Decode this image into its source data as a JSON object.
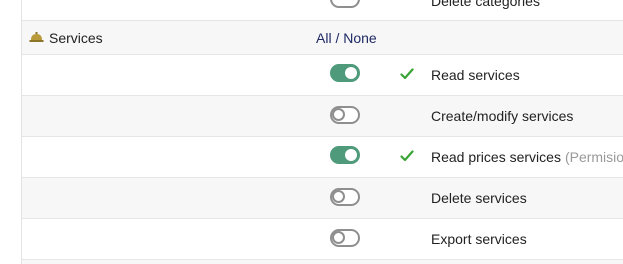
{
  "top_row": {
    "label": "Delete categories",
    "enabled": false
  },
  "section": {
    "title": "Services",
    "icon": "bell-icon",
    "all_label": "All",
    "separator": " / ",
    "none_label": "None"
  },
  "permissions": [
    {
      "label": "Read services",
      "enabled": true,
      "granted": true,
      "hint": ""
    },
    {
      "label": "Create/modify services",
      "enabled": false,
      "granted": false,
      "hint": ""
    },
    {
      "label": "Read prices services",
      "enabled": true,
      "granted": true,
      "hint": "(Permision"
    },
    {
      "label": "Delete services",
      "enabled": false,
      "granted": false,
      "hint": ""
    },
    {
      "label": "Export services",
      "enabled": false,
      "granted": false,
      "hint": ""
    }
  ],
  "colors": {
    "toggle_on": "#4e9a7a",
    "toggle_off_border": "#8f8f8f",
    "check": "#3aa335",
    "link": "#1f2a66",
    "row_alt": "#f7f7f7"
  }
}
